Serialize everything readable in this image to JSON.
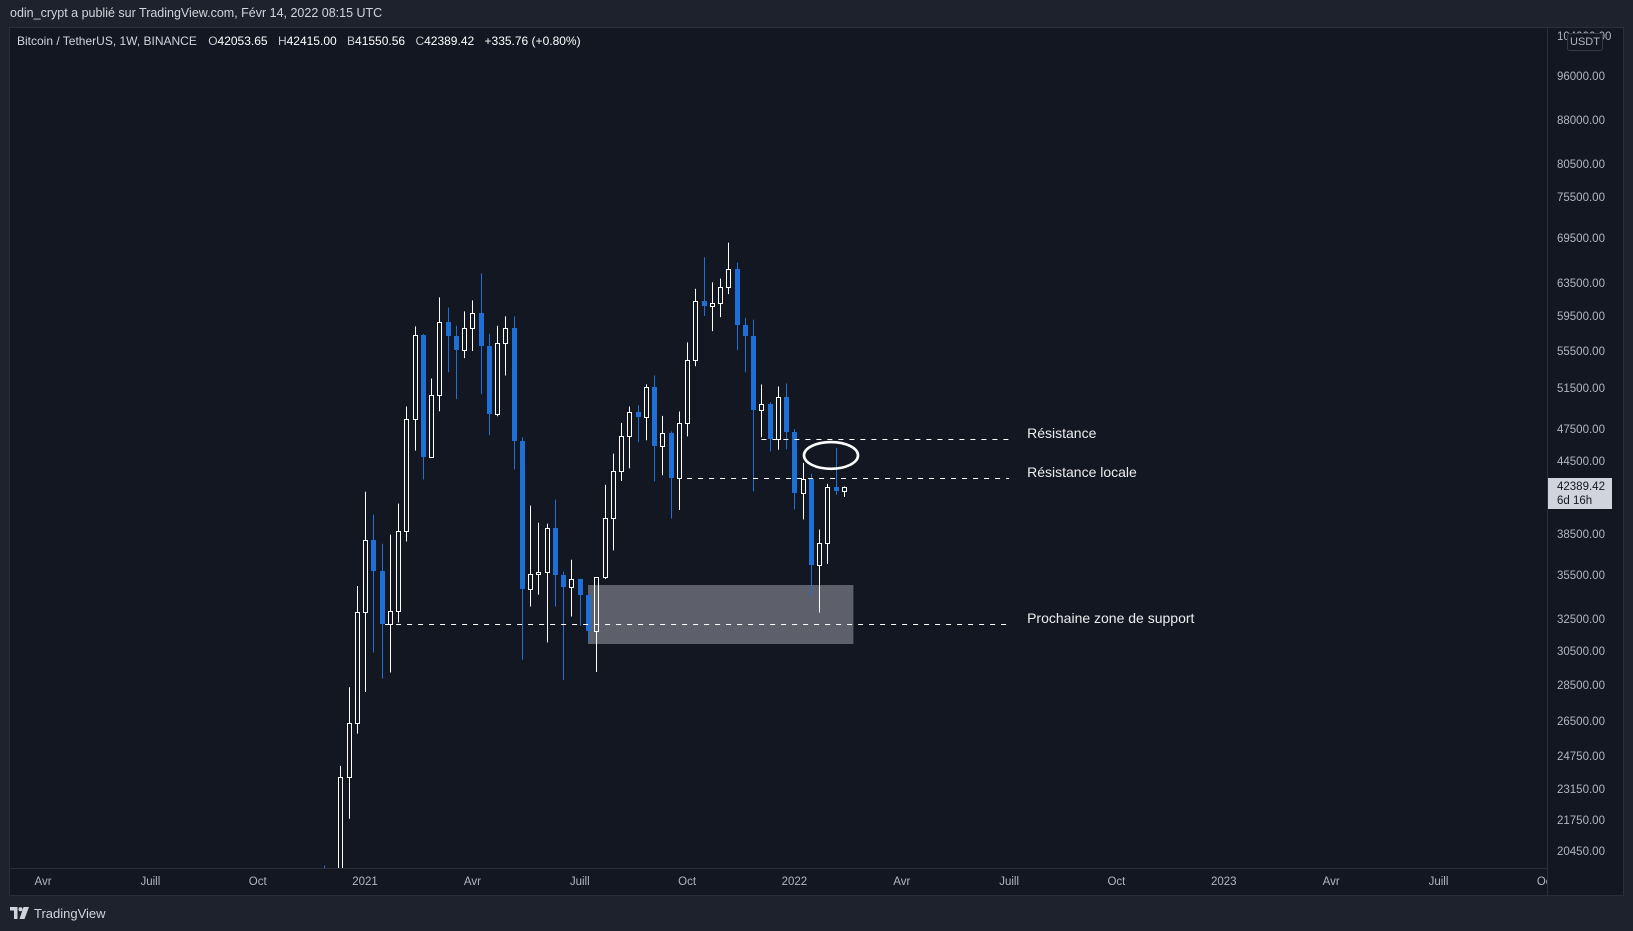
{
  "header": {
    "published_by": "odin_crypt a publié sur TradingView.com, Févr 14, 2022 08:15 UTC"
  },
  "legend": {
    "symbol": "Bitcoin / TetherUS, 1W, BINANCE",
    "open_label": "O",
    "open": "42053.65",
    "high_label": "H",
    "high": "42415.00",
    "low_label": "B",
    "low": "41550.56",
    "close_label": "C",
    "close": "42389.42",
    "change": "+335.76 (+0.80%)"
  },
  "price_axis": {
    "currency": "USDT",
    "current_price_label": "42389.42",
    "countdown": "6d 16h"
  },
  "footer": {
    "brand": "TradingView",
    "logo_icon": "tradingview-logo"
  },
  "colors": {
    "bullish": "#ffffff",
    "bearish": "#1e6fd6",
    "zone": "#5d606b",
    "annotation": "#ffffff",
    "background": "#131722"
  },
  "chart_data": {
    "type": "bar",
    "bar_style": "candlestick",
    "title": "Bitcoin / TetherUS, 1W, BINANCE",
    "xlabel": "",
    "ylabel": "USDT",
    "y_scale": "log",
    "grid": false,
    "xlim": [
      "2020-03-09",
      "2023-10-03"
    ],
    "ylim": [
      19815,
      105880
    ],
    "current_price": 42389.42,
    "y_ticks": [
      {
        "value": 104000,
        "label": "104000.00"
      },
      {
        "value": 96000,
        "label": "96000.00"
      },
      {
        "value": 88000,
        "label": "88000.00"
      },
      {
        "value": 80500,
        "label": "80500.00"
      },
      {
        "value": 75500,
        "label": "75500.00"
      },
      {
        "value": 69500,
        "label": "69500.00"
      },
      {
        "value": 63500,
        "label": "63500.00"
      },
      {
        "value": 59500,
        "label": "59500.00"
      },
      {
        "value": 55500,
        "label": "55500.00"
      },
      {
        "value": 51500,
        "label": "51500.00"
      },
      {
        "value": 47500,
        "label": "47500.00"
      },
      {
        "value": 44500,
        "label": "44500.00"
      },
      {
        "value": 38500,
        "label": "38500.00"
      },
      {
        "value": 35500,
        "label": "35500.00"
      },
      {
        "value": 32500,
        "label": "32500.00"
      },
      {
        "value": 30500,
        "label": "30500.00"
      },
      {
        "value": 28500,
        "label": "28500.00"
      },
      {
        "value": 26500,
        "label": "26500.00"
      },
      {
        "value": 24750,
        "label": "24750.00"
      },
      {
        "value": 23150,
        "label": "23150.00"
      },
      {
        "value": 21750,
        "label": "21750.00"
      },
      {
        "value": 20450,
        "label": "20450.00"
      }
    ],
    "x_ticks": [
      {
        "date": "2020-04-06",
        "label": "Avr"
      },
      {
        "date": "2020-07-06",
        "label": "Juill"
      },
      {
        "date": "2020-10-05",
        "label": "Oct"
      },
      {
        "date": "2021-01-04",
        "label": "2021"
      },
      {
        "date": "2021-04-05",
        "label": "Avr"
      },
      {
        "date": "2021-07-05",
        "label": "Juill"
      },
      {
        "date": "2021-10-04",
        "label": "Oct"
      },
      {
        "date": "2022-01-03",
        "label": "2022"
      },
      {
        "date": "2022-04-04",
        "label": "Avr"
      },
      {
        "date": "2022-07-04",
        "label": "Juill"
      },
      {
        "date": "2022-10-03",
        "label": "Oct"
      },
      {
        "date": "2023-01-02",
        "label": "2023"
      },
      {
        "date": "2023-04-03",
        "label": "Avr"
      },
      {
        "date": "2023-07-03",
        "label": "Juill"
      },
      {
        "date": "2023-10-02",
        "label": "Oct"
      }
    ],
    "candle_fields": [
      "week_start",
      "open",
      "high",
      "low",
      "close"
    ],
    "candles": [
      [
        "2020-11-30",
        19695,
        19915,
        18110,
        19359
      ],
      [
        "2020-12-14",
        19274,
        24295,
        19000,
        23738
      ],
      [
        "2020-12-21",
        23738,
        28422,
        21860,
        26443
      ],
      [
        "2020-12-28",
        26443,
        34778,
        25910,
        33000
      ],
      [
        "2021-01-04",
        33000,
        41980,
        28150,
        38150
      ],
      [
        "2021-01-11",
        38150,
        40100,
        30460,
        35810
      ],
      [
        "2021-01-18",
        35810,
        37840,
        28920,
        32210
      ],
      [
        "2021-01-25",
        32210,
        38530,
        29270,
        33080
      ],
      [
        "2021-02-01",
        33080,
        40990,
        32340,
        38810
      ],
      [
        "2021-02-08",
        38810,
        49760,
        38010,
        48550
      ],
      [
        "2021-02-15",
        48550,
        58380,
        45570,
        57400
      ],
      [
        "2021-02-22",
        57400,
        57500,
        43010,
        45030
      ],
      [
        "2021-03-01",
        45030,
        52620,
        44950,
        50930
      ],
      [
        "2021-03-08",
        50930,
        61860,
        49290,
        58930
      ],
      [
        "2021-03-15",
        58930,
        60630,
        53280,
        57250
      ],
      [
        "2021-03-22",
        57250,
        58460,
        50490,
        55680
      ],
      [
        "2021-03-29",
        55680,
        60150,
        54800,
        58230
      ],
      [
        "2021-04-05",
        58230,
        61490,
        55580,
        60000
      ],
      [
        "2021-04-12",
        60000,
        64890,
        51000,
        56130
      ],
      [
        "2021-04-19",
        56130,
        57530,
        46980,
        49000
      ],
      [
        "2021-04-26",
        49000,
        58460,
        48800,
        56470
      ],
      [
        "2021-05-03",
        56470,
        59560,
        52930,
        58190
      ],
      [
        "2021-05-10",
        58190,
        59560,
        43880,
        46420
      ],
      [
        "2021-05-17",
        46420,
        46800,
        30020,
        34590
      ],
      [
        "2021-05-24",
        34590,
        40830,
        33390,
        35620
      ],
      [
        "2021-05-31",
        35620,
        39460,
        34190,
        35800
      ],
      [
        "2021-06-07",
        35800,
        39380,
        31080,
        39070
      ],
      [
        "2021-06-14",
        39070,
        41320,
        33390,
        35580
      ],
      [
        "2021-06-21",
        35580,
        35800,
        28840,
        34690
      ],
      [
        "2021-06-28",
        34690,
        36650,
        32730,
        35270
      ],
      [
        "2021-07-05",
        35270,
        35300,
        32120,
        34190
      ],
      [
        "2021-07-12",
        34190,
        34250,
        31080,
        31770
      ],
      [
        "2021-07-19",
        31770,
        35410,
        29300,
        35410
      ],
      [
        "2021-07-26",
        35410,
        42550,
        35270,
        39840
      ],
      [
        "2021-08-02",
        39840,
        45290,
        37340,
        43760
      ],
      [
        "2021-08-09",
        43760,
        48160,
        42890,
        46930
      ],
      [
        "2021-08-16",
        46930,
        49760,
        43990,
        49230
      ],
      [
        "2021-08-23",
        49230,
        49900,
        46330,
        48700
      ],
      [
        "2021-08-30",
        48700,
        52000,
        46520,
        51750
      ],
      [
        "2021-09-06",
        51750,
        52930,
        42850,
        45960
      ],
      [
        "2021-09-13",
        45960,
        48830,
        43380,
        47200
      ],
      [
        "2021-09-20",
        47200,
        47350,
        39780,
        43120
      ],
      [
        "2021-09-27",
        43120,
        49270,
        40470,
        48160
      ],
      [
        "2021-10-04",
        48160,
        56550,
        46880,
        54620
      ],
      [
        "2021-10-11",
        54620,
        62940,
        53920,
        61450
      ],
      [
        "2021-10-18",
        61450,
        67010,
        59600,
        60790
      ],
      [
        "2021-10-25",
        60790,
        63740,
        57830,
        61210
      ],
      [
        "2021-11-01",
        61210,
        64220,
        59470,
        63200
      ],
      [
        "2021-11-08",
        63200,
        69000,
        62260,
        65500
      ],
      [
        "2021-11-15",
        65500,
        66310,
        55680,
        58530
      ],
      [
        "2021-11-22",
        58530,
        59400,
        53280,
        57250
      ],
      [
        "2021-11-29",
        57250,
        59170,
        42010,
        49400
      ],
      [
        "2021-12-06",
        49400,
        51990,
        46800,
        50050
      ],
      [
        "2021-12-13",
        50050,
        50200,
        45500,
        46610
      ],
      [
        "2021-12-20",
        46610,
        51780,
        45640,
        50730
      ],
      [
        "2021-12-27",
        50730,
        52100,
        45690,
        47270
      ],
      [
        "2022-01-03",
        47270,
        47570,
        40520,
        41840
      ],
      [
        "2022-01-10",
        41840,
        44470,
        39720,
        43070
      ],
      [
        "2022-01-17",
        43070,
        43500,
        34060,
        36240
      ],
      [
        "2022-01-24",
        36240,
        38920,
        32990,
        37890
      ],
      [
        "2022-01-31",
        37890,
        42640,
        36350,
        42380
      ],
      [
        "2022-02-07",
        42380,
        45820,
        41710,
        42050
      ],
      [
        "2022-02-14",
        42053.65,
        42415.0,
        41550.56,
        42389.42
      ]
    ],
    "annotations": {
      "horizontal_lines": [
        {
          "name": "resistance",
          "label": "Résistance",
          "price": 46650,
          "from": "2021-12-06",
          "to": "2022-07-04",
          "style": "dashed"
        },
        {
          "name": "local-resistance",
          "label": "Résistance locale",
          "price": 43150,
          "from": "2021-10-04",
          "to": "2022-07-04",
          "style": "dashed"
        },
        {
          "name": "support",
          "label": "Prochaine zone de support",
          "price": 32250,
          "from": "2021-01-21",
          "to": "2022-07-04",
          "style": "dashed"
        }
      ],
      "rectangles": [
        {
          "name": "support-zone",
          "from": "2021-07-12",
          "to": "2022-02-22",
          "price_top": 34850,
          "price_bottom": 30980
        }
      ],
      "ellipses": [
        {
          "name": "highlight",
          "from": "2022-01-10",
          "to": "2022-02-27",
          "price_top": 46470,
          "price_bottom": 43830
        }
      ]
    }
  }
}
